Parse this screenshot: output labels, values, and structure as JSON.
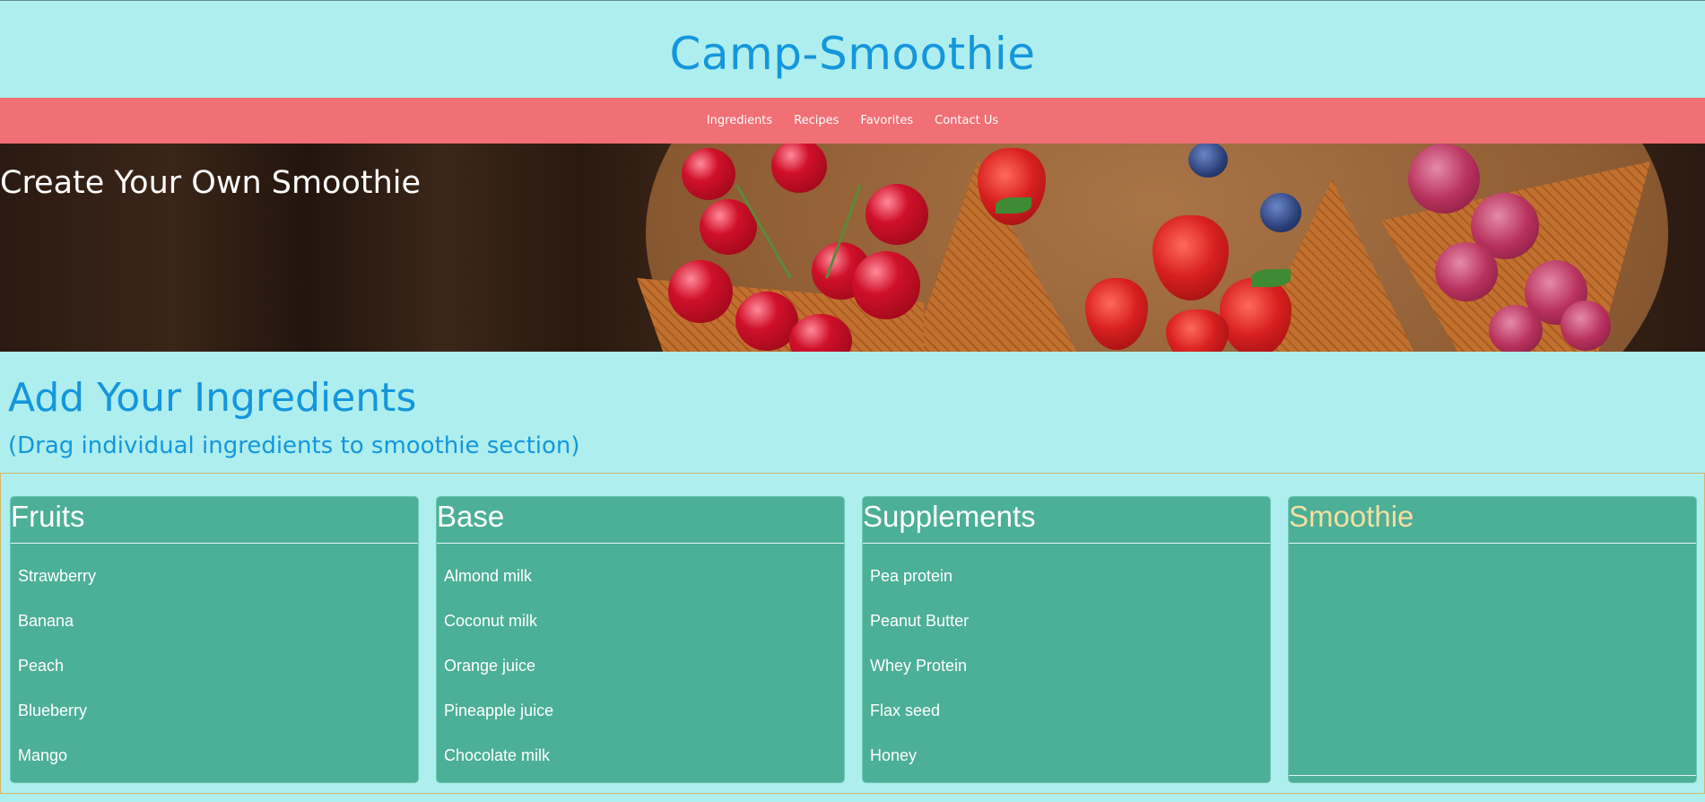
{
  "header": {
    "title": "Camp-Smoothie"
  },
  "nav": {
    "items": [
      {
        "label": "Ingredients"
      },
      {
        "label": "Recipes"
      },
      {
        "label": "Favorites"
      },
      {
        "label": "Contact Us"
      }
    ]
  },
  "hero": {
    "title": "Create Your Own Smoothie"
  },
  "section": {
    "title": "Add Your Ingredients",
    "subtitle": "(Drag individual ingredients to smoothie section)"
  },
  "columns": [
    {
      "title": "Fruits",
      "items": [
        "Strawberry",
        "Banana",
        "Peach",
        "Blueberry",
        "Mango"
      ]
    },
    {
      "title": "Base",
      "items": [
        "Almond milk",
        "Coconut milk",
        "Orange juice",
        "Pineapple juice",
        "Chocolate milk"
      ]
    },
    {
      "title": "Supplements",
      "items": [
        "Pea protein",
        "Peanut Butter",
        "Whey Protein",
        "Flax seed",
        "Honey"
      ]
    },
    {
      "title": "Smoothie",
      "items": []
    }
  ],
  "colors": {
    "page_bg": "#aeeeee",
    "title_blue": "#1496dc",
    "nav_bg": "#f07075",
    "column_bg": "#4caf98",
    "smoothie_title": "#f6dfa0"
  }
}
